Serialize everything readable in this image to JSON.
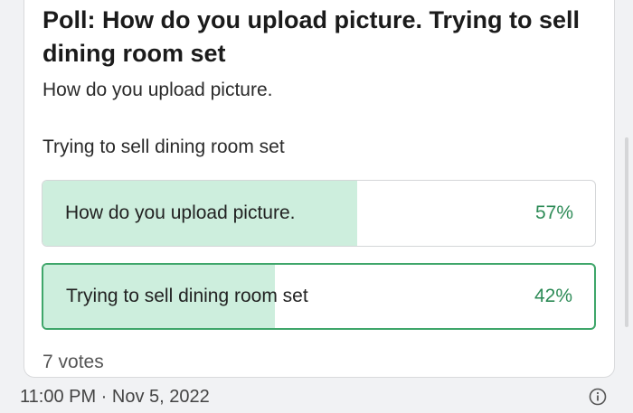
{
  "poll": {
    "title": "Poll: How do you upload picture. Trying to sell dining room set",
    "description_line1": "How do you upload picture.",
    "description_line2": "Trying to sell dining room set",
    "options": [
      {
        "label": "How do you upload picture.",
        "percent": "57%",
        "fill": 0.57
      },
      {
        "label": "Trying to sell dining room set",
        "percent": "42%",
        "fill": 0.42
      }
    ],
    "votes": "7 votes"
  },
  "footer": {
    "timestamp": "11:00 PM · Nov 5, 2022",
    "info_icon": "info-icon"
  },
  "colors": {
    "fill": "#cdeedd",
    "accent": "#3fa66a",
    "percent": "#2e8b57"
  }
}
